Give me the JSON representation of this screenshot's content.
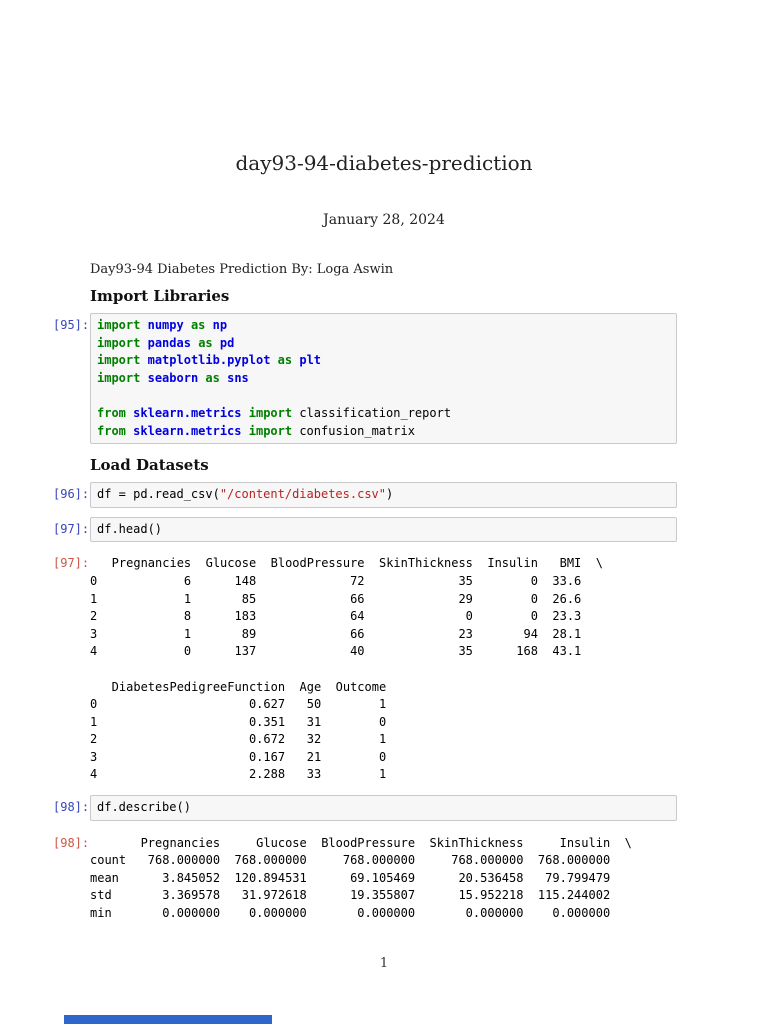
{
  "document": {
    "title": "day93-94-diabetes-prediction",
    "date": "January 28, 2024",
    "byline": "Day93-94 Diabetes Prediction By: Loga Aswin",
    "page_number": "1"
  },
  "headings": {
    "import_libraries": "Import Libraries",
    "load_datasets": "Load Datasets"
  },
  "cells": {
    "c95": {
      "in_prompt": "[95]:",
      "lines": [
        [
          [
            "k",
            "import"
          ],
          [
            "p",
            " "
          ],
          [
            "n",
            "numpy"
          ],
          [
            "p",
            " "
          ],
          [
            "k",
            "as"
          ],
          [
            "p",
            " "
          ],
          [
            "n",
            "np"
          ]
        ],
        [
          [
            "k",
            "import"
          ],
          [
            "p",
            " "
          ],
          [
            "n",
            "pandas"
          ],
          [
            "p",
            " "
          ],
          [
            "k",
            "as"
          ],
          [
            "p",
            " "
          ],
          [
            "n",
            "pd"
          ]
        ],
        [
          [
            "k",
            "import"
          ],
          [
            "p",
            " "
          ],
          [
            "n",
            "matplotlib.pyplot"
          ],
          [
            "p",
            " "
          ],
          [
            "k",
            "as"
          ],
          [
            "p",
            " "
          ],
          [
            "n",
            "plt"
          ]
        ],
        [
          [
            "k",
            "import"
          ],
          [
            "p",
            " "
          ],
          [
            "n",
            "seaborn"
          ],
          [
            "p",
            " "
          ],
          [
            "k",
            "as"
          ],
          [
            "p",
            " "
          ],
          [
            "n",
            "sns"
          ]
        ],
        [],
        [
          [
            "k",
            "from"
          ],
          [
            "p",
            " "
          ],
          [
            "n",
            "sklearn.metrics"
          ],
          [
            "p",
            " "
          ],
          [
            "k",
            "import"
          ],
          [
            "p",
            " classification_report"
          ]
        ],
        [
          [
            "k",
            "from"
          ],
          [
            "p",
            " "
          ],
          [
            "n",
            "sklearn.metrics"
          ],
          [
            "p",
            " "
          ],
          [
            "k",
            "import"
          ],
          [
            "p",
            " confusion_matrix"
          ]
        ]
      ]
    },
    "c96": {
      "in_prompt": "[96]:",
      "lines": [
        [
          [
            "p",
            "df = pd.read_csv("
          ],
          [
            "s",
            "\"/content/diabetes.csv\""
          ],
          [
            "p",
            ")"
          ]
        ]
      ]
    },
    "c97": {
      "in_prompt": "[97]:",
      "lines": [
        [
          [
            "p",
            "df.head()"
          ]
        ]
      ]
    },
    "c98": {
      "in_prompt": "[98]:",
      "lines": [
        [
          [
            "p",
            "df.describe()"
          ]
        ]
      ]
    }
  },
  "outputs": {
    "o97": {
      "prompt": "[97]:",
      "text": "   Pregnancies  Glucose  BloodPressure  SkinThickness  Insulin   BMI  \\\n0            6      148             72             35        0  33.6\n1            1       85             66             29        0  26.6\n2            8      183             64              0        0  23.3\n3            1       89             66             23       94  28.1\n4            0      137             40             35      168  43.1\n\n   DiabetesPedigreeFunction  Age  Outcome\n0                     0.627   50        1\n1                     0.351   31        0\n2                     0.672   32        1\n3                     0.167   21        0\n4                     2.288   33        1"
    },
    "o98": {
      "prompt": "[98]:",
      "text": "       Pregnancies     Glucose  BloodPressure  SkinThickness     Insulin  \\\ncount   768.000000  768.000000     768.000000     768.000000  768.000000\nmean      3.845052  120.894531      69.105469      20.536458   79.799479\nstd       3.369578   31.972618      19.355807      15.952218  115.244002\nmin       0.000000    0.000000       0.000000       0.000000    0.000000"
    }
  },
  "colors": {
    "keyword_green": "#008000",
    "namespace_blue": "#0000E0",
    "string_red": "#BA2121",
    "in_prompt_blue": "#3745BD",
    "out_prompt_red": "#CB5645",
    "cell_background": "#F7F7F7",
    "cell_border": "#C9C9C9",
    "bottom_bar_blue": "#2E66CC"
  }
}
